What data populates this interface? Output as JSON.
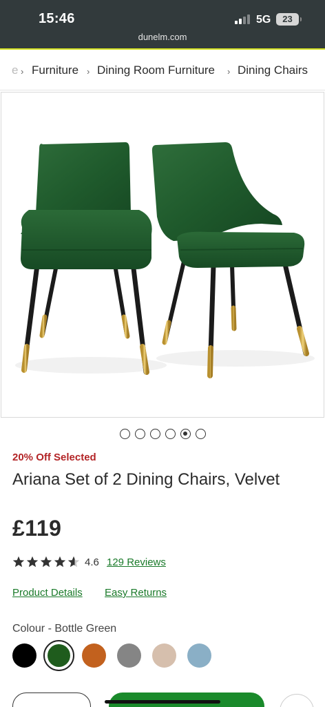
{
  "status_bar": {
    "time": "15:46",
    "network": "5G",
    "battery": "23",
    "url": "dunelm.com"
  },
  "breadcrumb": {
    "truncated_prefix": "e",
    "items": [
      "Furniture",
      "Dining Room Furniture",
      "Dining Chairs"
    ],
    "separator": "›"
  },
  "product": {
    "image_icon": "dining-chairs-photo",
    "carousel": {
      "count": 6,
      "active_index": 4
    },
    "offer": "20% Off Selected",
    "title": "Ariana Set of 2 Dining Chairs, Velvet",
    "price": "£119",
    "rating": {
      "stars": 4.6,
      "score": "4.6",
      "reviews": "129 Reviews"
    },
    "links": {
      "details": "Product Details",
      "returns": "Easy Returns"
    },
    "colour_label": "Colour - Bottle Green",
    "swatches": [
      {
        "name": "Black",
        "hex": "#000000",
        "selected": false
      },
      {
        "name": "Bottle Green",
        "hex": "#1f5c1d",
        "selected": true
      },
      {
        "name": "Orange",
        "hex": "#c2611e",
        "selected": false
      },
      {
        "name": "Grey",
        "hex": "#858585",
        "selected": false
      },
      {
        "name": "Natural",
        "hex": "#d6bfad",
        "selected": false
      },
      {
        "name": "Blue",
        "hex": "#8aafc6",
        "selected": false
      }
    ]
  },
  "colors": {
    "status_bg": "#323a3c",
    "accent": "#d3e021",
    "offer_red": "#b32426",
    "link_green": "#1a7a2a",
    "button_green": "#1a8a2b"
  }
}
